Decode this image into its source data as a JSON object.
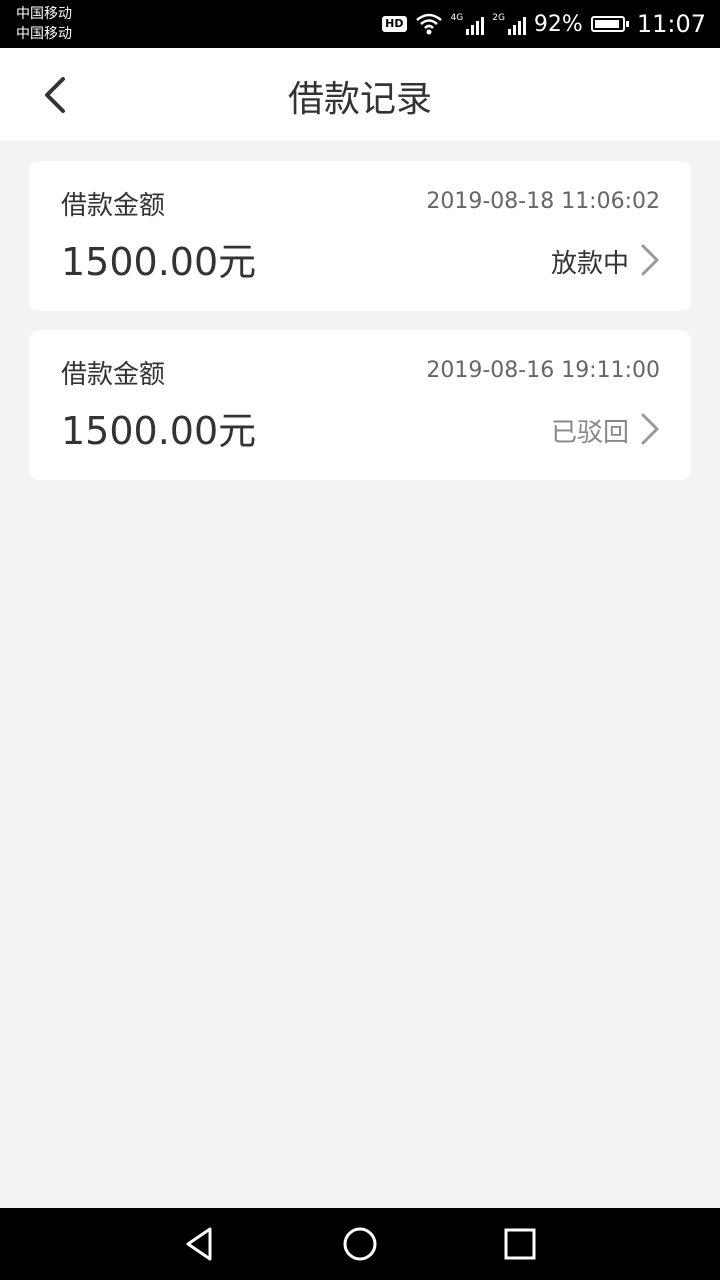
{
  "status_bar": {
    "carrier_1": "中国移动",
    "carrier_2": "中国移动",
    "hd": "HD",
    "network_1": "4G",
    "network_2": "2G",
    "battery_percent": "92%",
    "battery_level": 0.92,
    "time": "11:07"
  },
  "header": {
    "title": "借款记录",
    "back_icon": "chevron-left-icon"
  },
  "records": [
    {
      "label": "借款金额",
      "time": "2019-08-18 11:06:02",
      "amount": "1500.00元",
      "status": "放款中",
      "status_color": "#333333"
    },
    {
      "label": "借款金额",
      "time": "2019-08-16 19:11:00",
      "amount": "1500.00元",
      "status": "已驳回",
      "status_color": "#888888"
    }
  ],
  "nav": {
    "back": "triangle-back-icon",
    "home": "circle-home-icon",
    "recents": "square-recents-icon"
  }
}
